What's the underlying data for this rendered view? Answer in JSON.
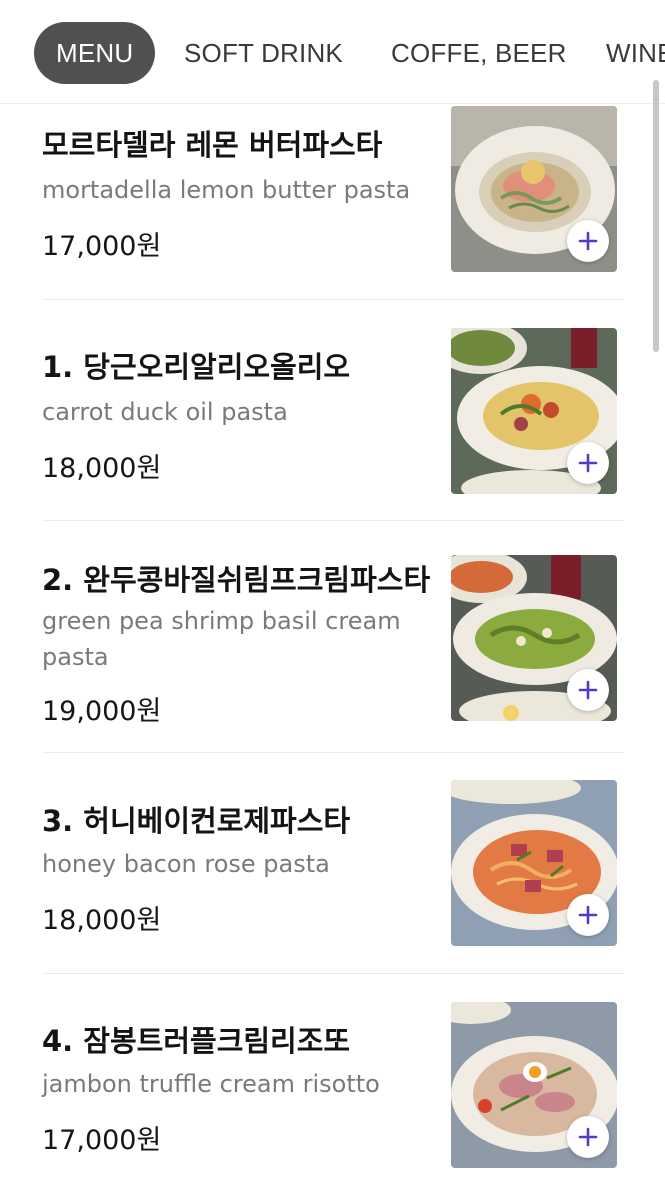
{
  "tabs": [
    {
      "label": "MENU",
      "active": true
    },
    {
      "label": "SOFT DRINK",
      "active": false
    },
    {
      "label": "COFFE, BEER",
      "active": false
    },
    {
      "label": "WINE",
      "active": false
    }
  ],
  "items": [
    {
      "name": "모르타델라 레몬 버터파스타",
      "desc": "mortadella lemon butter pasta",
      "price": "17,000원",
      "icon": "plus-icon"
    },
    {
      "name": "1. 당근오리알리오올리오",
      "desc": "carrot duck oil pasta",
      "price": "18,000원",
      "icon": "plus-icon"
    },
    {
      "name": "2. 완두콩바질쉬림프크림파스타",
      "desc": "green pea shrimp basil cream pasta",
      "price": "19,000원",
      "icon": "plus-icon"
    },
    {
      "name": "3. 허니베이컨로제파스타",
      "desc": "honey bacon rose pasta",
      "price": "18,000원",
      "icon": "plus-icon"
    },
    {
      "name": "4. 잠봉트러플크림리조또",
      "desc": "jambon truffle cream risotto",
      "price": "17,000원",
      "icon": "plus-icon"
    }
  ],
  "colors": {
    "active_tab_bg": "#505050",
    "plus_icon": "#4b3cc9",
    "price_text": "#161616",
    "desc_text": "#7a7a7a"
  }
}
